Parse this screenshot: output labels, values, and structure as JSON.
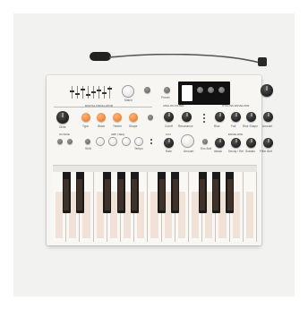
{
  "sections": {
    "digital_oscillator": "DIGITAL OSCILLATOR",
    "analog_filter": "ANALOG FILTER",
    "cycling_envelope": "CYCLING ENVELOPE",
    "mod": "MOD",
    "arp_seq": "ARP | SEQ",
    "lfo": "LFO",
    "envelope": "ENVELOPE"
  },
  "labels": {
    "type": "Type",
    "wave": "Wave",
    "timbre": "Timbre",
    "shape": "Shape",
    "glide": "Glide",
    "matrix": "Matrix",
    "preset": "Preset",
    "cutoff": "Cutoff",
    "resonance": "Resonance",
    "env_amt": "Env Amt",
    "rise": "Rise",
    "fall": "Fall",
    "rise_shape": "Rise Shape",
    "amount": "Amount",
    "octave": "OCTAVE",
    "rate": "Rate",
    "attack": "Attack",
    "decay_rel": "Decay / Rel",
    "sustain": "Sustain",
    "filter_amt": "Filter Amt",
    "volume": "Volume",
    "shift": "Shift",
    "tempo": "Tempo"
  },
  "colors": {
    "body": "#f7f6f3",
    "accent_orange": "#f08a3c",
    "knob_black": "#2a2a2a",
    "key_dots": "#c99268"
  }
}
